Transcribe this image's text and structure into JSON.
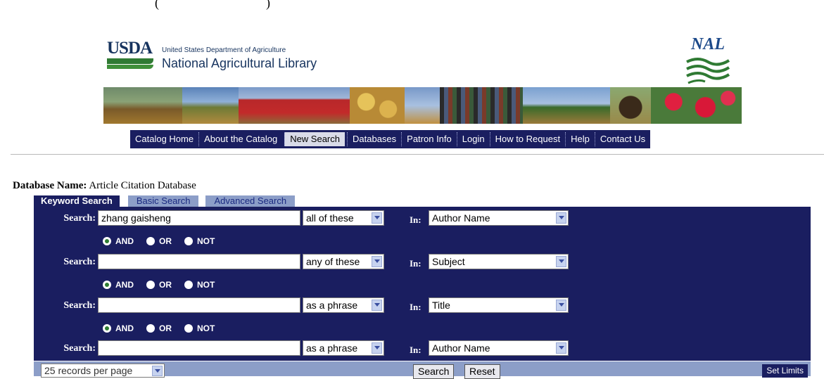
{
  "header": {
    "top_fragment_left": "(",
    "top_fragment_right": ")",
    "usda_logo_text": "USDA",
    "dept_name": "United States Department of Agriculture",
    "library_name": "National Agricultural Library",
    "nal_logo_text": "NAL"
  },
  "nav": {
    "items": [
      {
        "label": "Catalog Home"
      },
      {
        "label": "About the Catalog"
      },
      {
        "label": "New Search"
      },
      {
        "label": "Databases"
      },
      {
        "label": "Patron Info"
      },
      {
        "label": "Login"
      },
      {
        "label": "How to Request"
      },
      {
        "label": "Help"
      },
      {
        "label": "Contact Us"
      }
    ],
    "active": "New Search"
  },
  "database": {
    "label": "Database Name:",
    "value": "Article Citation Database"
  },
  "tabs": {
    "keyword": "Keyword Search",
    "basic": "Basic Search",
    "advanced": "Advanced Search"
  },
  "search_rows": [
    {
      "label": "Search:",
      "value": "zhang gaisheng",
      "match": "all of these",
      "in_label": "In:",
      "field": "Author Name"
    },
    {
      "label": "Search:",
      "value": "",
      "match": "any of these",
      "in_label": "In:",
      "field": "Subject"
    },
    {
      "label": "Search:",
      "value": "",
      "match": "as a phrase",
      "in_label": "In:",
      "field": "Title"
    },
    {
      "label": "Search:",
      "value": "",
      "match": "as a phrase",
      "in_label": "In:",
      "field": "Author Name"
    }
  ],
  "boolean_ops": {
    "and": "AND",
    "or": "OR",
    "not": "NOT",
    "selected": "AND"
  },
  "footer": {
    "records_per_page": "25 records per page",
    "search_button": "Search",
    "reset_button": "Reset",
    "set_limits_button": "Set Limits"
  },
  "colors": {
    "panel": "#1a1e60",
    "tab_inactive": "#8c9ec8",
    "radio_selected": "#2e7d32"
  }
}
